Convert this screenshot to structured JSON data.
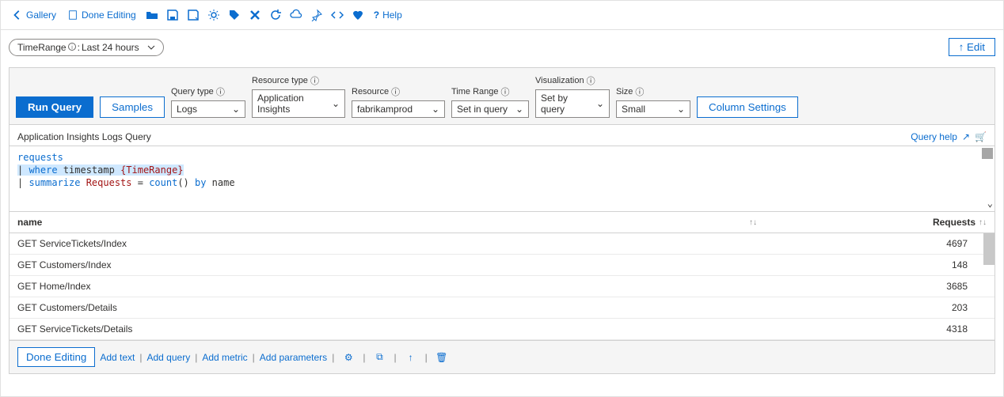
{
  "toolbar": {
    "gallery": "Gallery",
    "done_editing": "Done Editing",
    "help": "Help"
  },
  "param_pill": {
    "name": "TimeRange",
    "sep": " : ",
    "value": "Last 24 hours"
  },
  "edit_button": "↑ Edit",
  "query_controls": {
    "run_query": "Run Query",
    "samples": "Samples",
    "query_type": {
      "label": "Query type",
      "value": "Logs"
    },
    "resource_type": {
      "label": "Resource type",
      "value": "Application Insights"
    },
    "resource": {
      "label": "Resource",
      "value": "fabrikamprod"
    },
    "time_range": {
      "label": "Time Range",
      "value": "Set in query"
    },
    "visualization": {
      "label": "Visualization",
      "value": "Set by query"
    },
    "size": {
      "label": "Size",
      "value": "Small"
    },
    "column_settings": "Column Settings"
  },
  "query_title": "Application Insights Logs Query",
  "query_help": "Query help",
  "editor": {
    "line1": "requests",
    "l2_pipe": "|",
    "l2_where": " where ",
    "l2_ts": "timestamp ",
    "l2_param": "{TimeRange}",
    "l3_pipe": "| ",
    "l3_sum": "summarize ",
    "l3_req": "Requests",
    "l3_eq": " = ",
    "l3_count": "count",
    "l3_paren": "() ",
    "l3_by": "by",
    "l3_name": " name"
  },
  "table": {
    "headers": {
      "name": "name",
      "requests": "Requests"
    },
    "rows": [
      {
        "name": "GET ServiceTickets/Index",
        "requests": "4697"
      },
      {
        "name": "GET Customers/Index",
        "requests": "148"
      },
      {
        "name": "GET Home/Index",
        "requests": "3685"
      },
      {
        "name": "GET Customers/Details",
        "requests": "203"
      },
      {
        "name": "GET ServiceTickets/Details",
        "requests": "4318"
      }
    ]
  },
  "footer": {
    "done_editing": "Done Editing",
    "add_text": "Add text",
    "add_query": "Add query",
    "add_metric": "Add metric",
    "add_parameters": "Add parameters"
  }
}
